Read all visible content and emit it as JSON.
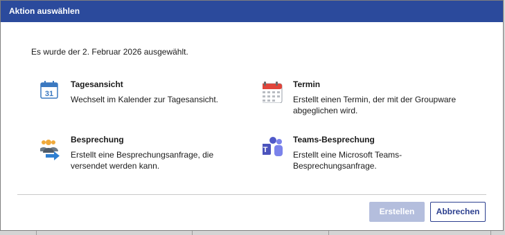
{
  "dialog": {
    "title": "Aktion auswählen",
    "intro": "Es wurde der 2. Februar 2026 ausgewählt."
  },
  "options": [
    {
      "title": "Tagesansicht",
      "description": "Wechselt im Kalender zur Tagesansicht.",
      "icon": "calendar-day-icon",
      "icon_text": "31"
    },
    {
      "title": "Termin",
      "description": "Erstellt einen Termin, der mit der Groupware abgeglichen wird.",
      "icon": "calendar-grid-icon"
    },
    {
      "title": "Besprechung",
      "description": "Erstellt eine Besprechungsanfrage, die versendet werden kann.",
      "icon": "meeting-people-icon"
    },
    {
      "title": "Teams-Besprechung",
      "description": "Erstellt eine Microsoft Teams-Besprechungsanfrage.",
      "icon": "teams-icon"
    }
  ],
  "buttons": {
    "create": "Erstellen",
    "cancel": "Abbrechen"
  },
  "colors": {
    "titlebar": "#2b4a9c",
    "create_disabled": "#b4bedd",
    "cancel_border": "#2b3f8f"
  }
}
